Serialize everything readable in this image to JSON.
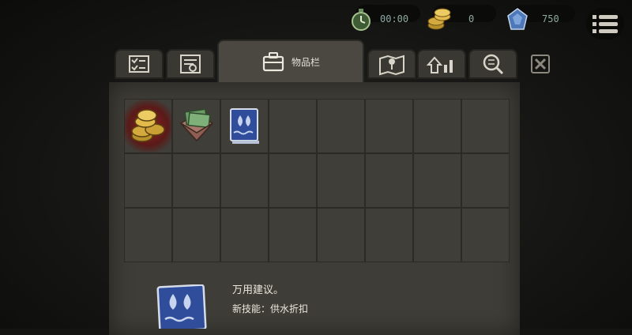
{
  "hud": {
    "timer": {
      "icon": "stopwatch-icon",
      "value": "00:00"
    },
    "coins": {
      "icon": "coin-stack-icon",
      "value": "0"
    },
    "gems": {
      "icon": "gem-icon",
      "value": "750"
    },
    "menu": {
      "icon": "menu-list-icon"
    }
  },
  "tabs": [
    {
      "name": "tab-checklist",
      "icon": "checklist-icon"
    },
    {
      "name": "tab-notes",
      "icon": "notepad-icon"
    },
    {
      "name": "tab-inventory",
      "icon": "briefcase-icon",
      "label": "物品栏",
      "active": true
    },
    {
      "name": "tab-map",
      "icon": "map-icon"
    },
    {
      "name": "tab-upgrades",
      "icon": "upgrade-arrows-icon"
    },
    {
      "name": "tab-search",
      "icon": "magnifier-icon"
    }
  ],
  "close": {
    "icon": "close-icon"
  },
  "inventory": {
    "rows": 3,
    "cols": 8,
    "items": [
      {
        "slot": 0,
        "icon": "gold-coins-icon",
        "selected": true
      },
      {
        "slot": 1,
        "icon": "cash-envelope-icon",
        "selected": false
      },
      {
        "slot": 2,
        "icon": "blue-book-icon",
        "selected": false
      }
    ]
  },
  "detail": {
    "icon": "blue-book-icon",
    "title": "万用建议。",
    "subtitle": "新技能：供水折扣"
  },
  "colors": {
    "background": "#141412",
    "panel": "#3f3d37",
    "hud_text": "#8fa9a3",
    "selected_slot": "#8a2222",
    "book_blue": "#2f4d9a"
  }
}
